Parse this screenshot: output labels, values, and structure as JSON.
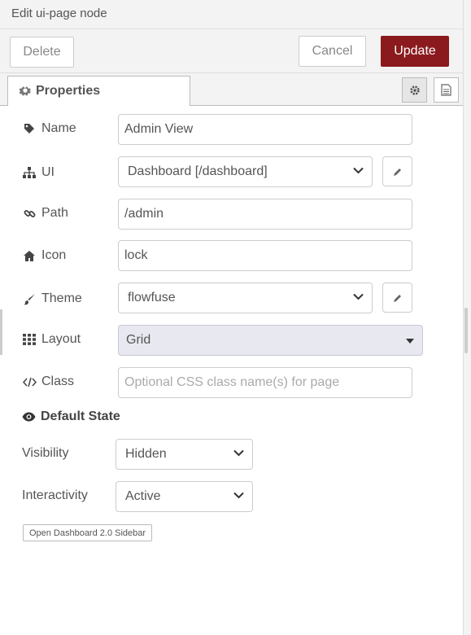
{
  "header": {
    "title": "Edit ui-page node"
  },
  "toolbar": {
    "delete_label": "Delete",
    "cancel_label": "Cancel",
    "update_label": "Update",
    "accent": "#8b1a1e"
  },
  "tabs": {
    "properties_label": "Properties"
  },
  "fields": {
    "name": {
      "label": "Name",
      "value": "Admin View",
      "icon": "tag-icon"
    },
    "ui": {
      "label": "UI",
      "value": "Dashboard [/dashboard]",
      "icon": "sitemap-icon"
    },
    "path": {
      "label": "Path",
      "value": "/admin",
      "icon": "link-icon"
    },
    "icon": {
      "label": "Icon",
      "value": "lock",
      "icon": "home-icon"
    },
    "theme": {
      "label": "Theme",
      "value": "flowfuse",
      "icon": "paintbrush-icon"
    },
    "layout": {
      "label": "Layout",
      "value": "Grid",
      "icon": "grid-icon"
    },
    "class": {
      "label": "Class",
      "placeholder": "Optional CSS class name(s) for page",
      "icon": "code-icon"
    }
  },
  "default_state": {
    "title": "Default State",
    "visibility": {
      "label": "Visibility",
      "value": "Hidden"
    },
    "interactivity": {
      "label": "Interactivity",
      "value": "Active"
    }
  },
  "sidebar_button": {
    "label": "Open Dashboard 2.0 Sidebar"
  }
}
